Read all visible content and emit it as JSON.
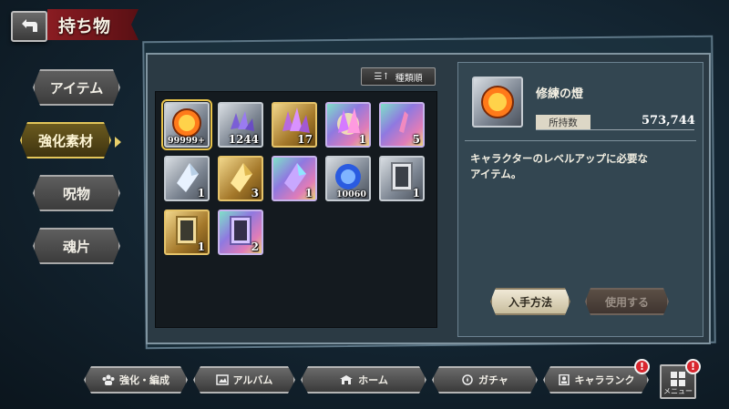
{
  "header": {
    "title": "持ち物"
  },
  "tabs": [
    {
      "label": "アイテム",
      "active": false
    },
    {
      "label": "強化素材",
      "active": true
    },
    {
      "label": "呪物",
      "active": false
    },
    {
      "label": "魂片",
      "active": false
    }
  ],
  "sort": {
    "label": "種類順"
  },
  "items": [
    {
      "count": "99999+",
      "rarity": "silver",
      "gem": "fire-orb",
      "selected": true
    },
    {
      "count": "1244",
      "rarity": "silver",
      "gem": "crystal-cluster-purple"
    },
    {
      "count": "17",
      "rarity": "gold",
      "gem": "crystal-cluster-purple"
    },
    {
      "count": "1",
      "rarity": "rainbow",
      "gem": "crystal-cluster-glow"
    },
    {
      "count": "5",
      "rarity": "rainbow",
      "gem": "shard-pink"
    },
    {
      "count": "1",
      "rarity": "silver",
      "gem": "crystal-white"
    },
    {
      "count": "3",
      "rarity": "gold",
      "gem": "crystal-gold"
    },
    {
      "count": "1",
      "rarity": "rainbow",
      "gem": "crystal-rainbow"
    },
    {
      "count": "10060",
      "rarity": "silver",
      "gem": "blue-orb"
    },
    {
      "count": "1",
      "rarity": "silver",
      "gem": "mirror-silver"
    },
    {
      "count": "1",
      "rarity": "gold",
      "gem": "mirror-gold"
    },
    {
      "count": "2",
      "rarity": "rainbow",
      "gem": "mirror-rainbow"
    }
  ],
  "detail": {
    "name": "修練の燈",
    "qty_label": "所持数",
    "qty_value": "573,744",
    "description_line1": "キャラクターのレベルアップに必要な",
    "description_line2": "アイテム。",
    "get_button": "入手方法",
    "use_button": "使用する"
  },
  "nav": [
    {
      "label": "強化・編成",
      "icon": "group-icon"
    },
    {
      "label": "アルバム",
      "icon": "album-icon"
    },
    {
      "label": "ホーム",
      "icon": "home-icon"
    },
    {
      "label": "ガチャ",
      "icon": "gacha-icon"
    },
    {
      "label": "キャラランク",
      "icon": "rank-icon"
    }
  ],
  "menu": {
    "label": "メニュー"
  },
  "badges": {
    "rank": "!",
    "menu": "!"
  },
  "colors": {
    "accent_gold": "#e9c44a",
    "title_red": "#8a1c22",
    "badge_red": "#d8262e"
  }
}
